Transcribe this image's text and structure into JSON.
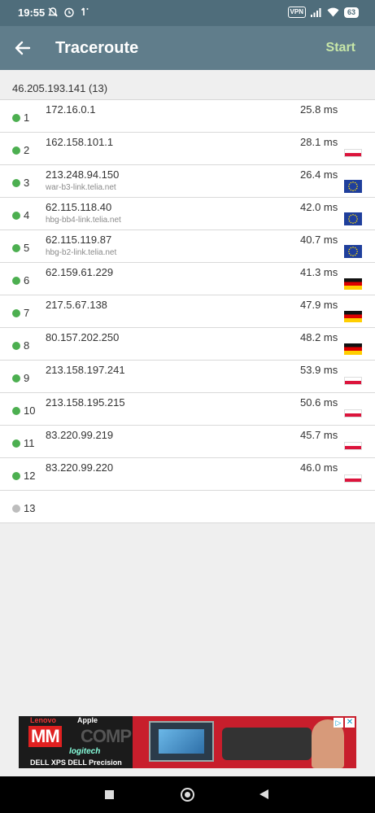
{
  "status_bar": {
    "time": "19:55",
    "left_icons": [
      "notifications-off-icon",
      "alarm-icon",
      "sync-icon"
    ],
    "vpn_label": "VPN",
    "battery_level": "63"
  },
  "app_bar": {
    "title": "Traceroute",
    "action_label": "Start"
  },
  "target": "46.205.193.141 (13)",
  "colors": {
    "accent": "#607d8b",
    "status_bar": "#4f6d7b",
    "start": "#c7e6a8",
    "hop_ok": "#4caf50",
    "hop_pending": "#bdbdbd"
  },
  "hops": [
    {
      "num": "1",
      "ip": "172.16.0.1",
      "host": "",
      "ms": "25.8 ms",
      "flag": "",
      "status": "ok"
    },
    {
      "num": "2",
      "ip": "162.158.101.1",
      "host": "",
      "ms": "28.1 ms",
      "flag": "pl",
      "status": "ok"
    },
    {
      "num": "3",
      "ip": "213.248.94.150",
      "host": "war-b3-link.telia.net",
      "ms": "26.4 ms",
      "flag": "eu",
      "status": "ok"
    },
    {
      "num": "4",
      "ip": "62.115.118.40",
      "host": "hbg-bb4-link.telia.net",
      "ms": "42.0 ms",
      "flag": "eu",
      "status": "ok"
    },
    {
      "num": "5",
      "ip": "62.115.119.87",
      "host": "hbg-b2-link.telia.net",
      "ms": "40.7 ms",
      "flag": "eu",
      "status": "ok"
    },
    {
      "num": "6",
      "ip": "62.159.61.229",
      "host": "",
      "ms": "41.3 ms",
      "flag": "de",
      "status": "ok"
    },
    {
      "num": "7",
      "ip": "217.5.67.138",
      "host": "",
      "ms": "47.9 ms",
      "flag": "de",
      "status": "ok"
    },
    {
      "num": "8",
      "ip": "80.157.202.250",
      "host": "",
      "ms": "48.2 ms",
      "flag": "de",
      "status": "ok"
    },
    {
      "num": "9",
      "ip": "213.158.197.241",
      "host": "",
      "ms": "53.9 ms",
      "flag": "pl",
      "status": "ok"
    },
    {
      "num": "10",
      "ip": "213.158.195.215",
      "host": "",
      "ms": "50.6 ms",
      "flag": "pl",
      "status": "ok"
    },
    {
      "num": "11",
      "ip": "83.220.99.219",
      "host": "",
      "ms": "45.7 ms",
      "flag": "pl",
      "status": "ok"
    },
    {
      "num": "12",
      "ip": "83.220.99.220",
      "host": "",
      "ms": "46.0 ms",
      "flag": "pl",
      "status": "ok"
    },
    {
      "num": "13",
      "ip": "",
      "host": "",
      "ms": "",
      "flag": "",
      "status": "pending"
    }
  ],
  "ad": {
    "line1a": "Lenovo",
    "line1b": "Apple",
    "brand_a": "MM",
    "brand_b": "COMP",
    "logitech": "logitech",
    "dell": "DELL XPS  DELL Precision",
    "info_glyph": "▷",
    "close_glyph": "✕"
  },
  "nav_bar": {
    "buttons": [
      "recents-icon",
      "home-icon",
      "back-icon"
    ]
  }
}
